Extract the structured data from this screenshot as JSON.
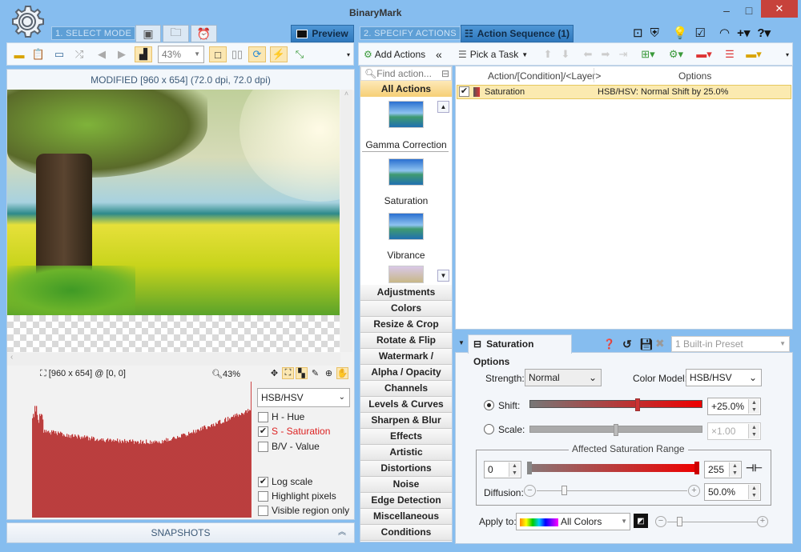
{
  "app": {
    "logo_text": "BinaryMark",
    "accent": "#2f78bd"
  },
  "window_controls": {
    "minimize": "–",
    "maximize": "□",
    "close": "✕"
  },
  "header": {
    "step1": "1. SELECT MODE",
    "step2": "2. SPECIFY ACTIONS",
    "mode_tabs": [
      "batch-icon",
      "file-browser-icon",
      "schedule-icon"
    ],
    "preview_tab": "Preview",
    "sequence_tab": "Action Sequence (1)",
    "right_icons": [
      "console-icon",
      "shield-icon",
      "lightbulb-icon",
      "checklist-icon",
      "feed-icon",
      "plus-icon",
      "help-icon"
    ]
  },
  "left_toolbar": {
    "zoom_value": "43%"
  },
  "preview": {
    "title": "MODIFIED [960 x 654] (72.0 dpi, 72.0 dpi)",
    "dimensions": "[960 x 654] @ [0, 0]",
    "zoom": "43%"
  },
  "histogram": {
    "color_model": "HSB/HSV",
    "channels": [
      {
        "label": "H - Hue",
        "checked": false
      },
      {
        "label": "S - Saturation",
        "checked": true
      },
      {
        "label": "B/V - Value",
        "checked": false
      }
    ],
    "options": [
      {
        "label": "Log scale",
        "checked": true
      },
      {
        "label": "Highlight pixels",
        "checked": false
      },
      {
        "label": "Visible region only",
        "checked": false
      }
    ]
  },
  "snapshots": {
    "label": "SNAPSHOTS"
  },
  "right_toolbar": {
    "add_actions": "Add Actions",
    "collapse": "«",
    "pick_task": "Pick a Task"
  },
  "actions": {
    "search_placeholder": "Find action...",
    "all_actions": "All Actions",
    "thumbnails": [
      "Gamma Correction",
      "Saturation",
      "Vibrance"
    ],
    "categories": [
      "Adjustments",
      "Colors",
      "Resize & Crop",
      "Rotate & Flip",
      "Watermark / Overlay",
      "Alpha / Opacity",
      "Channels",
      "Levels & Curves",
      "Sharpen & Blur",
      "Effects",
      "Artistic",
      "Distortions",
      "Noise",
      "Edge Detection",
      "Miscellaneous",
      "Conditions"
    ]
  },
  "sequence": {
    "columns": [
      "Action/[Condition]/<Layer>",
      "Options"
    ],
    "rows": [
      {
        "checked": true,
        "action": "Saturation",
        "options": "HSB/HSV: Normal Shift by 25.0%"
      }
    ]
  },
  "options_panel": {
    "title": "Saturation Options",
    "preset": "1 Built-in Preset",
    "strength_label": "Strength:",
    "strength_value": "Normal",
    "color_model_label": "Color Model:",
    "color_model_value": "HSB/HSV",
    "shift_label": "Shift:",
    "shift_value": "+25.0%",
    "shift_selected": true,
    "shift_fraction": 0.625,
    "scale_label": "Scale:",
    "scale_value": "×1.00",
    "scale_fraction": 0.5,
    "range_title": "Affected Saturation Range",
    "range_min": "0",
    "range_max": "255",
    "diffusion_label": "Diffusion:",
    "diffusion_value": "50.0%",
    "apply_label": "Apply to:",
    "apply_value": "All Colors"
  }
}
